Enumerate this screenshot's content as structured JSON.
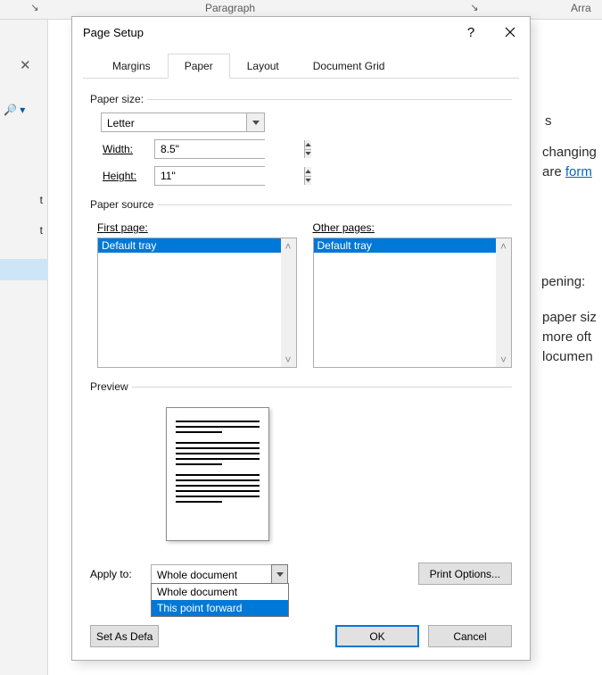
{
  "ribbon": {
    "group1_label": "Paragraph",
    "group2_label": "Arra"
  },
  "sidebar": {
    "nav1_suffix": "t",
    "nav2_suffix": "t"
  },
  "background": {
    "frag1": "s",
    "frag2": "changing",
    "frag3_plain": "are ",
    "frag3_link": "form",
    "frag4": "pening:",
    "frag5": "paper siz",
    "frag6": "more oft",
    "frag7": "locumen"
  },
  "dialog": {
    "title": "Page Setup",
    "help_symbol": "?",
    "tabs": {
      "margins": "Margins",
      "paper": "Paper",
      "layout": "Layout",
      "docgrid": "Document Grid"
    },
    "paper_size": {
      "legend": "Paper size:",
      "selected": "Letter",
      "width_label_u": "W",
      "width_label_rest": "idth:",
      "width_value": "8.5\"",
      "height_label_plain": "H",
      "height_label_u": "e",
      "height_label_rest": "ight:",
      "height_value": "11\""
    },
    "paper_source": {
      "legend": "Paper source",
      "first_u": "F",
      "first_rest": "irst page:",
      "first_items": [
        "Default tray"
      ],
      "other_u": "O",
      "other_rest": "ther pages:",
      "other_items": [
        "Default tray"
      ]
    },
    "preview": {
      "legend": "Preview"
    },
    "apply": {
      "label": "Apply to:",
      "selected": "Whole document",
      "options": [
        "Whole document",
        "This point forward"
      ],
      "highlight_index": 1
    },
    "print_options": "Print Options...",
    "set_default": "Set As Defa",
    "ok": "OK",
    "cancel": "Cancel"
  }
}
